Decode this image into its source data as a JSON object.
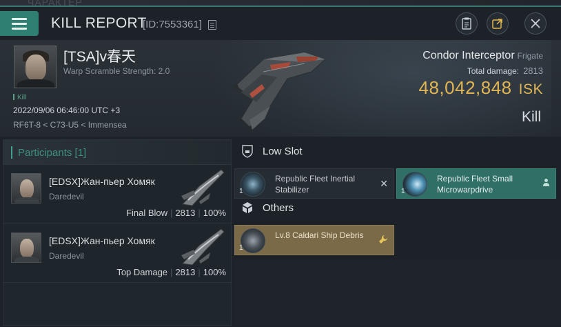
{
  "background_title": "ЧАРАКТЕР",
  "header": {
    "title": "KILL REPORT",
    "id_label": "[ID:7553361]",
    "buttons": [
      "clipboard-icon",
      "external-link-icon",
      "close-icon"
    ]
  },
  "victim": {
    "name": "[TSA]v春天",
    "subtitle": "Warp Scramble Strength: 2.0",
    "tag": "Kill",
    "datetime": "2022/09/06 06:46:00 UTC +3",
    "location": "RF6T-8 < C73-U5 < Immensea"
  },
  "ship": {
    "name": "Condor Interceptor",
    "class": "Frigate",
    "total_damage_label": "Total damage:",
    "total_damage": "2813",
    "isk_value": "48,042,848",
    "isk_unit": "ISK",
    "result": "Kill"
  },
  "participants": {
    "header": "Participants [1]",
    "rows": [
      {
        "name": "[EDSX]Жан-пьер Хомяк",
        "ship": "Daredevil",
        "role": "Final Blow",
        "damage": "2813",
        "percent": "100%"
      },
      {
        "name": "[EDSX]Жан-пьер Хомяк",
        "ship": "Daredevil",
        "role": "Top Damage",
        "damage": "2813",
        "percent": "100%"
      }
    ]
  },
  "sections": {
    "low_slot": {
      "label": "Low Slot",
      "items": [
        {
          "qty": "1",
          "name": "Republic Fleet Inertial Stabilizer",
          "state": "destroyed"
        },
        {
          "qty": "1",
          "name": "Republic Fleet Small Microwarpdrive",
          "state": "dropped"
        }
      ]
    },
    "others": {
      "label": "Others",
      "items": [
        {
          "qty": "1",
          "name": "Lv.8 Caldari Ship Debris",
          "state": "dropped"
        }
      ]
    }
  },
  "colors": {
    "accent": "#2f7f72",
    "isk": "#e2b553",
    "drop": "#7a6a48",
    "highlight": "#2f6f66"
  }
}
